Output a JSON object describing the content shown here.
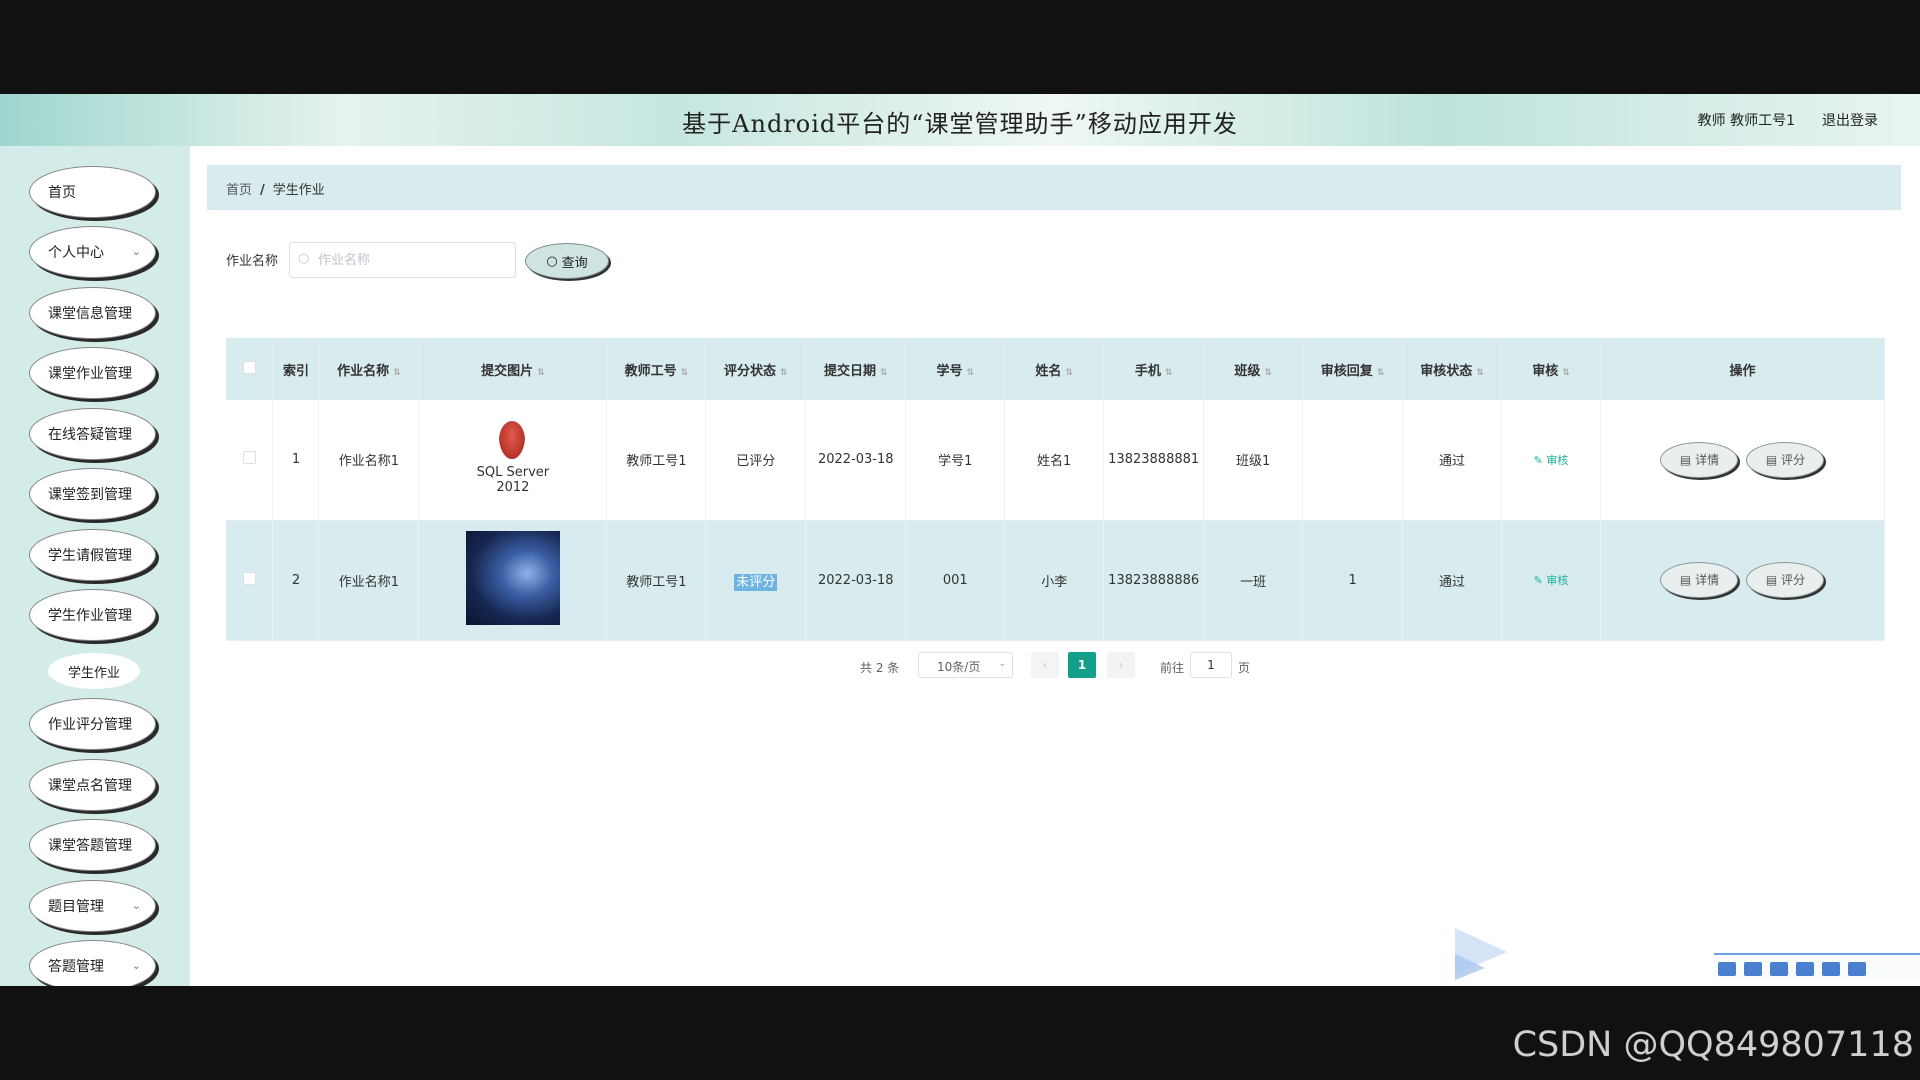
{
  "header": {
    "title": "基于Android平台的“课堂管理助手”移动应用开发",
    "user": "教师 教师工号1",
    "logout": "退出登录"
  },
  "sidebar": {
    "items": [
      {
        "label": "首页",
        "has_submenu": false
      },
      {
        "label": "个人中心",
        "has_submenu": true
      },
      {
        "label": "课堂信息管理",
        "has_submenu": false
      },
      {
        "label": "课堂作业管理",
        "has_submenu": false
      },
      {
        "label": "在线答疑管理",
        "has_submenu": false
      },
      {
        "label": "课堂签到管理",
        "has_submenu": false
      },
      {
        "label": "学生请假管理",
        "has_submenu": false
      },
      {
        "label": "学生作业管理",
        "has_submenu": false
      },
      {
        "label": "作业评分管理",
        "has_submenu": false
      },
      {
        "label": "课堂点名管理",
        "has_submenu": false
      },
      {
        "label": "课堂答题管理",
        "has_submenu": false
      },
      {
        "label": "题目管理",
        "has_submenu": true
      },
      {
        "label": "答题管理",
        "has_submenu": true
      }
    ],
    "sub_item": "学生作业"
  },
  "breadcrumb": {
    "home": "首页",
    "separator": "/",
    "current": "学生作业"
  },
  "search": {
    "label": "作业名称",
    "placeholder": "作业名称",
    "value": "",
    "button": "查询"
  },
  "table": {
    "headers": [
      "索引",
      "作业名称",
      "提交图片",
      "教师工号",
      "评分状态",
      "提交日期",
      "学号",
      "姓名",
      "手机",
      "班级",
      "审核回复",
      "审核状态",
      "审核",
      "操作"
    ],
    "rows": [
      {
        "index": "1",
        "name": "作业名称1",
        "image": "SQL Server 2012",
        "teacher_id": "教师工号1",
        "score_status": "已评分",
        "date": "2022-03-18",
        "student_id": "学号1",
        "student_name": "姓名1",
        "phone": "13823888881",
        "class": "班级1",
        "reply": "",
        "audit_status": "通过",
        "audit": "审核",
        "detail": "详情",
        "grade": "评分"
      },
      {
        "index": "2",
        "name": "作业名称1",
        "image": "",
        "teacher_id": "教师工号1",
        "score_status": "未评分",
        "date": "2022-03-18",
        "student_id": "001",
        "student_name": "小李",
        "phone": "13823888886",
        "class": "一班",
        "reply": "1",
        "audit_status": "通过",
        "audit": "审核",
        "detail": "详情",
        "grade": "评分"
      }
    ]
  },
  "pagination": {
    "total": "共 2 条",
    "page_size": "10条/页",
    "current_page": "1",
    "goto_label": "前往",
    "goto_value": "1",
    "page_unit": "页"
  },
  "watermark": "CSDN @QQ849807118",
  "colors": {
    "accent": "#13a08b",
    "header_bg": "#d8ebee",
    "sidebar_bg": "#d3ecea"
  }
}
